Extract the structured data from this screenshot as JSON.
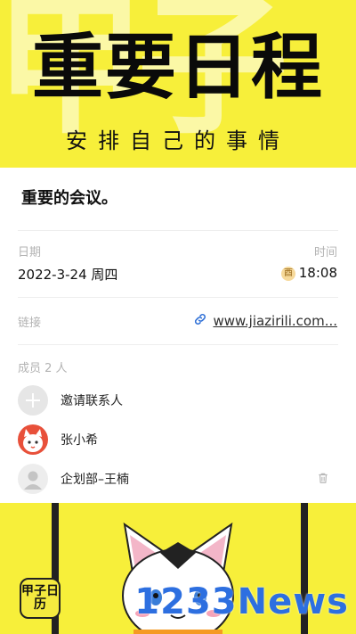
{
  "banner": {
    "watermark": "甲子",
    "title": "重要日程",
    "subtitle": "安排自己的事情"
  },
  "event": {
    "title": "重要的会议。",
    "date_label": "日期",
    "time_label": "时间",
    "date_value": "2022-3-24 周四",
    "stem_badge": "酉",
    "time_value": "18:08",
    "link_label": "链接",
    "link_value": "www.jiazirili.com..."
  },
  "members": {
    "header": "成员 2 人",
    "items": [
      {
        "name": "邀请联系人"
      },
      {
        "name": "张小希"
      },
      {
        "name": "企划部–王楠"
      }
    ]
  },
  "footer": {
    "app_icon_text": "甲子日历",
    "watermark_text": "1233News"
  },
  "colors": {
    "brand_yellow": "#f7ef3a",
    "link_icon": "#2e6fd6",
    "news_blue": "#2d6fe0"
  }
}
